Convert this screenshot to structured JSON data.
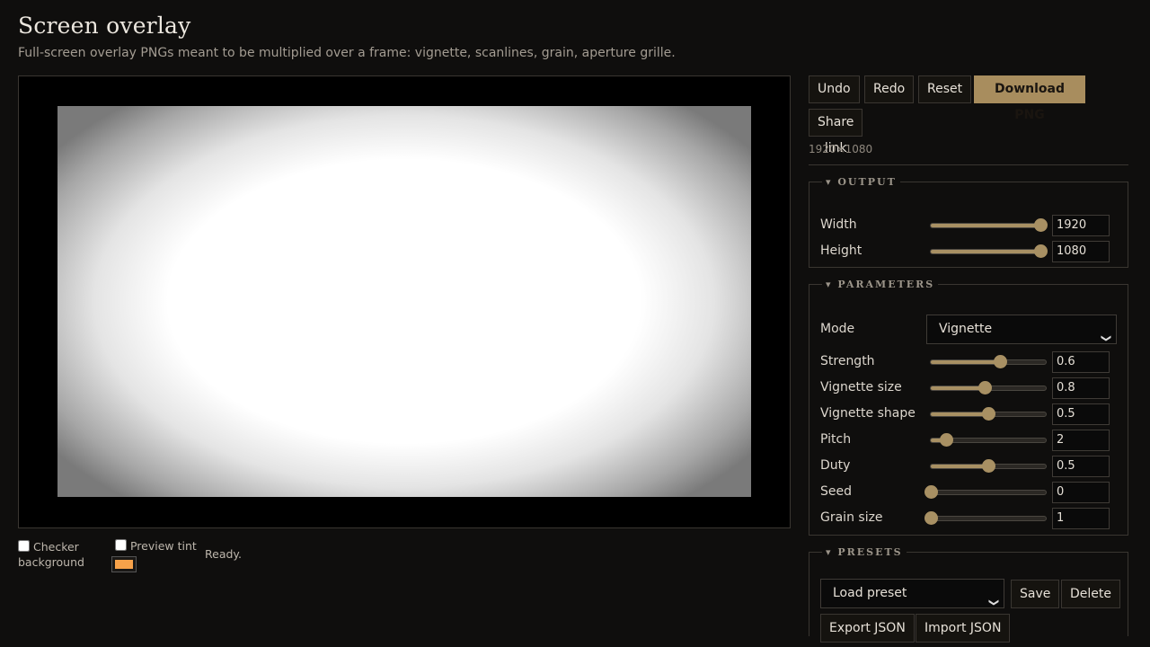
{
  "header": {
    "title": "Screen overlay",
    "subtitle": "Full-screen overlay PNGs meant to be multiplied over a frame: vignette, scanlines, grain, aperture grille."
  },
  "toolbar": {
    "undo": "Undo",
    "redo": "Redo",
    "reset": "Reset",
    "download": "Download PNG",
    "share": "Share link",
    "dimensions": "1920×1080"
  },
  "below_preview": {
    "checker_label": "Checker background",
    "tint_label": "Preview tint",
    "tint_color": "#f7a24a",
    "status": "Ready."
  },
  "output": {
    "legend": "▾ OUTPUT",
    "width": {
      "label": "Width",
      "value": "1920",
      "fraction": 0.95
    },
    "height": {
      "label": "Height",
      "value": "1080",
      "fraction": 0.95
    }
  },
  "parameters": {
    "legend": "▾ PARAMETERS",
    "mode": {
      "label": "Mode",
      "value": "Vignette"
    },
    "strength": {
      "label": "Strength",
      "value": "0.6",
      "fraction": 0.6
    },
    "vignette_size": {
      "label": "Vignette size",
      "value": "0.8",
      "fraction": 0.47
    },
    "vignette_shape": {
      "label": "Vignette shape",
      "value": "0.5",
      "fraction": 0.5
    },
    "pitch": {
      "label": "Pitch",
      "value": "2",
      "fraction": 0.13
    },
    "duty": {
      "label": "Duty",
      "value": "0.5",
      "fraction": 0.5
    },
    "seed": {
      "label": "Seed",
      "value": "0",
      "fraction": 0.0
    },
    "grain_size": {
      "label": "Grain size",
      "value": "1",
      "fraction": 0.0
    }
  },
  "presets": {
    "legend": "▾ PRESETS",
    "select_value": "Load preset",
    "save": "Save",
    "delete": "Delete",
    "export": "Export JSON",
    "import": "Import JSON"
  },
  "colors": {
    "accent": "#a88d5e",
    "background": "#0f0e0d"
  }
}
